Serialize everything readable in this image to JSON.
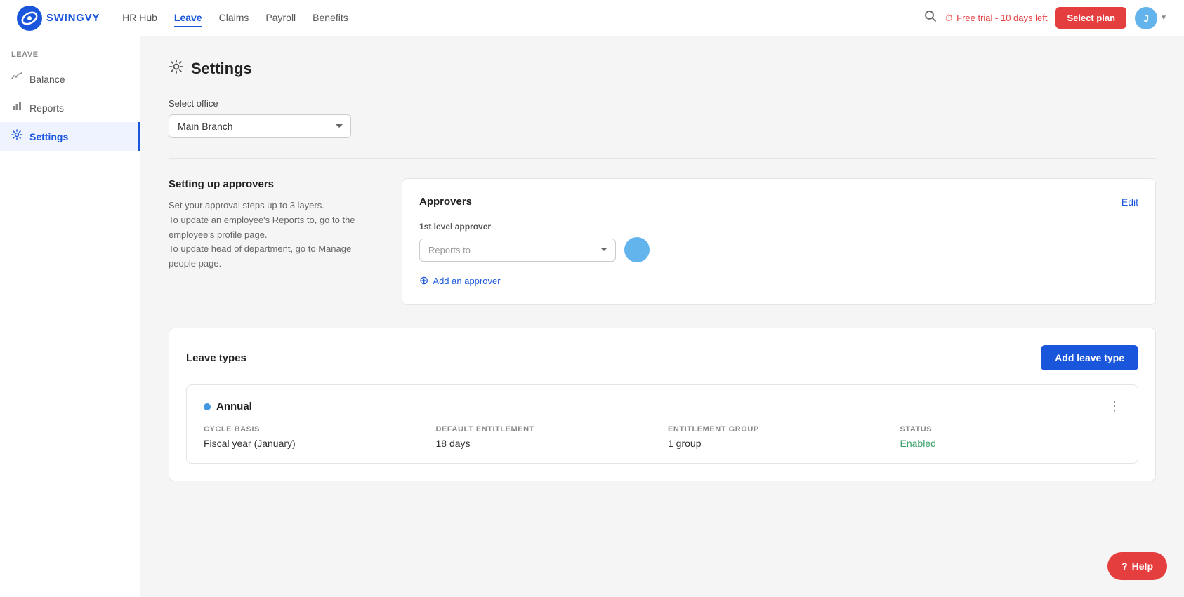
{
  "app": {
    "logo_text": "SWINGVY"
  },
  "topnav": {
    "links": [
      {
        "label": "HR Hub",
        "active": false
      },
      {
        "label": "Leave",
        "active": true
      },
      {
        "label": "Claims",
        "active": false
      },
      {
        "label": "Payroll",
        "active": false
      },
      {
        "label": "Benefits",
        "active": false
      }
    ],
    "free_trial_label": "Free trial - 10 days left",
    "select_plan_label": "Select plan",
    "user_initial": "J"
  },
  "sidebar": {
    "section_label": "LEAVE",
    "items": [
      {
        "label": "Balance",
        "icon": "〜",
        "active": false
      },
      {
        "label": "Reports",
        "icon": "📊",
        "active": false
      },
      {
        "label": "Settings",
        "icon": "⚙",
        "active": true
      }
    ]
  },
  "page": {
    "title": "Settings",
    "select_office_label": "Select office",
    "office_options": [
      "Main Branch"
    ],
    "selected_office": "Main Branch",
    "approvers_section": {
      "description_title": "Setting up approvers",
      "description_lines": [
        "Set your approval steps up to 3 layers.",
        "To update an employee's Reports to, go to the employee's profile page.",
        "To update head of department, go to Manage people page."
      ],
      "card_title": "Approvers",
      "edit_label": "Edit",
      "level1_label": "1st level approver",
      "approver_placeholder": "Reports to",
      "add_approver_label": "Add an approver"
    },
    "leave_types_section": {
      "title": "Leave types",
      "add_button_label": "Add leave type",
      "items": [
        {
          "name": "Annual",
          "dot_color": "#4299e1",
          "cycle_basis_label": "CYCLE BASIS",
          "cycle_basis_value": "Fiscal year (January)",
          "default_entitlement_label": "DEFAULT ENTITLEMENT",
          "default_entitlement_value": "18 days",
          "entitlement_group_label": "ENTITLEMENT GROUP",
          "entitlement_group_value": "1 group",
          "status_label": "STATUS",
          "status_value": "Enabled"
        }
      ]
    }
  },
  "help_button": {
    "label": "Help"
  }
}
